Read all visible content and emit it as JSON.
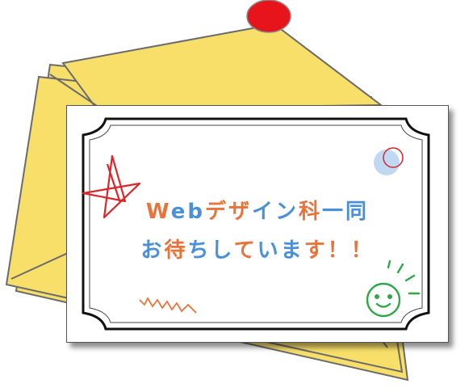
{
  "message": {
    "line1": [
      {
        "t": "W",
        "c": "#e8743b"
      },
      {
        "t": "e",
        "c": "#4a90d9"
      },
      {
        "t": "b",
        "c": "#4a90d9"
      },
      {
        "t": "デ",
        "c": "#e8743b"
      },
      {
        "t": "ザ",
        "c": "#e8743b"
      },
      {
        "t": "イ",
        "c": "#4a90d9"
      },
      {
        "t": "ン",
        "c": "#4a90d9"
      },
      {
        "t": "科",
        "c": "#e8743b"
      },
      {
        "t": "一",
        "c": "#4a90d9"
      },
      {
        "t": "同",
        "c": "#4a90d9"
      }
    ],
    "line2": [
      {
        "t": "お",
        "c": "#4a90d9"
      },
      {
        "t": "待",
        "c": "#e8743b"
      },
      {
        "t": "ち",
        "c": "#4a90d9"
      },
      {
        "t": "し",
        "c": "#4a90d9"
      },
      {
        "t": "て",
        "c": "#e8743b"
      },
      {
        "t": "い",
        "c": "#4a90d9"
      },
      {
        "t": "ま",
        "c": "#4a90d9"
      },
      {
        "t": "す",
        "c": "#e8743b"
      },
      {
        "t": "！",
        "c": "#e8743b"
      },
      {
        "t": "！",
        "c": "#e8743b"
      }
    ]
  },
  "colors": {
    "envelope": "#f7df6a",
    "envelope_edge": "#6b6b6b",
    "pin": "#e8141b",
    "star": "#d9262b",
    "smiley": "#2ea84a",
    "zigzag": "#e8743b",
    "dots": "#4a90d9"
  },
  "icons": [
    "red-pin-icon",
    "star-doodle-icon",
    "smiley-sun-icon",
    "zigzag-doodle-icon",
    "dot-circle-icon"
  ]
}
